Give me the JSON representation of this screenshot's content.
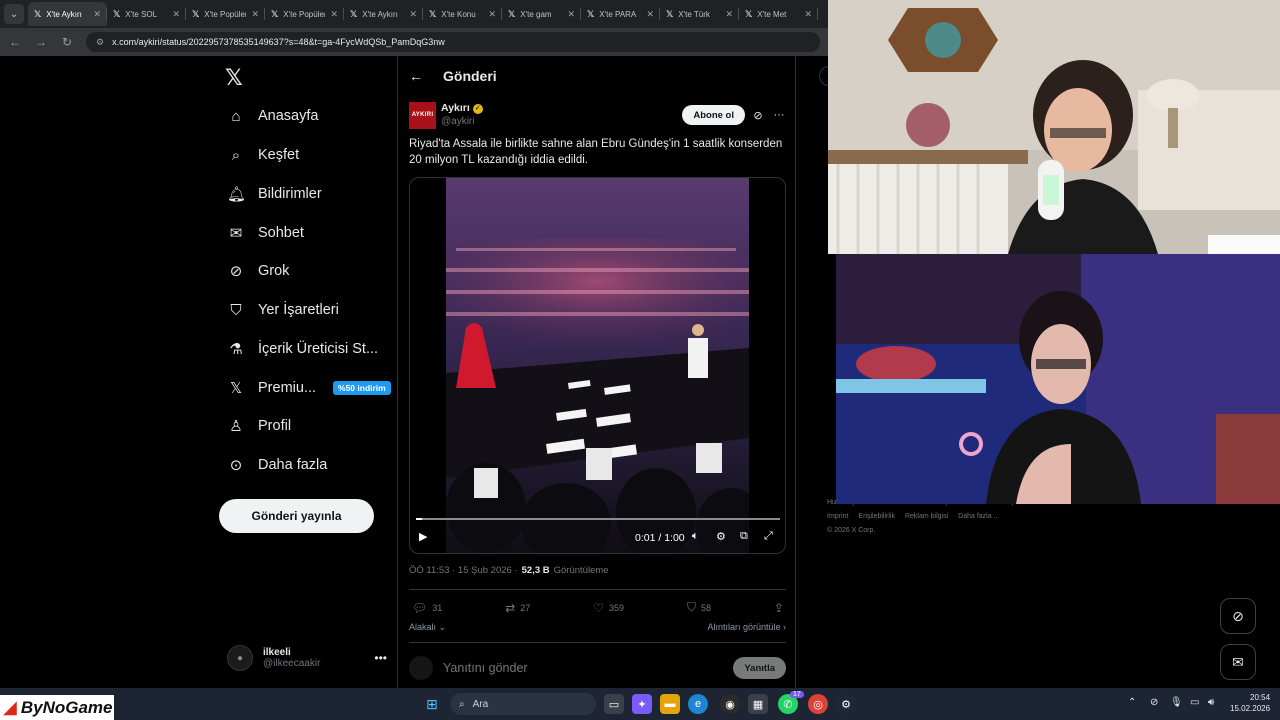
{
  "browser": {
    "tabs": [
      {
        "label": "X'te Aykırı",
        "active": true
      },
      {
        "label": "X'te SOL",
        "active": false
      },
      {
        "label": "X'te Popüler",
        "active": false
      },
      {
        "label": "X'te Popüler",
        "active": false
      },
      {
        "label": "X'te Aykırı",
        "active": false
      },
      {
        "label": "X'te Konu",
        "active": false
      },
      {
        "label": "X'te gam",
        "active": false
      },
      {
        "label": "X'te PARA",
        "active": false
      },
      {
        "label": "X'te Türk",
        "active": false
      },
      {
        "label": "X'te Met",
        "active": false
      }
    ],
    "url": "x.com/aykiri/status/2022957378535149637?s=48&t=ga-4FycWdQSb_PamDqG3nw"
  },
  "sidebar": {
    "logo": "𝕏",
    "items": [
      {
        "label": "Anasayfa",
        "icon": "home-icon",
        "glyph": "⌂"
      },
      {
        "label": "Keşfet",
        "icon": "search-icon",
        "glyph": "⌕"
      },
      {
        "label": "Bildirimler",
        "icon": "bell-icon",
        "glyph": "🔔︎"
      },
      {
        "label": "Sohbet",
        "icon": "mail-icon",
        "glyph": "✉"
      },
      {
        "label": "Grok",
        "icon": "grok-icon",
        "glyph": "⊘"
      },
      {
        "label": "Yer İşaretleri",
        "icon": "bookmark-icon",
        "glyph": "⛉"
      },
      {
        "label": "İçerik Üreticisi St...",
        "icon": "flask-icon",
        "glyph": "⚗"
      },
      {
        "label": "Premiu...",
        "icon": "premium-x-icon",
        "glyph": "𝕏"
      },
      {
        "label": "Profil",
        "icon": "profile-icon",
        "glyph": "♙"
      },
      {
        "label": "Daha fazla",
        "icon": "more-circle-icon",
        "glyph": "⊙"
      }
    ],
    "premium_badge": "%50 indirim",
    "post_button": "Gönderi yayınla",
    "account": {
      "name": "ilkeeli",
      "handle": "@ilkeecaakir"
    }
  },
  "post": {
    "header_title": "Gönderi",
    "author_name": "Aykırı",
    "author_handle": "@aykiri",
    "avatar_text": "AYKIRI",
    "follow_label": "Abone ol",
    "text": "Riyad'ta Assala ile birlikte sahne alan Ebru Gündeş'in 1 saatlik konserden 20 milyon TL kazandığı iddia edildi.",
    "video": {
      "time": "0:01 / 1:00",
      "progress_fraction": 0.017
    },
    "timestamp": "ÖÖ 11:53 · 15 Şub 2026 ·",
    "views_count": "52,3 B",
    "views_label": "Görüntüleme",
    "replies": "31",
    "reposts": "27",
    "likes": "359",
    "bookmarks": "58",
    "sort_label": "Alakalı",
    "quotes_label": "Alıntıları görüntüle",
    "reply_placeholder": "Yanıtını gönder",
    "reply_button": "Yanıtla"
  },
  "footer": {
    "row1": [
      "Hizmet Şartları",
      "Gizlilik Politikası",
      "Çerez Politikası",
      "Erişilebilirlik"
    ],
    "row2": [
      "Imprint",
      "Erişilebilirlik",
      "Reklam bilgisi",
      "Daha fazla ..."
    ],
    "copyright": "© 2026 X Corp."
  },
  "taskbar": {
    "brand": "ByNoGame",
    "search_placeholder": "Ara",
    "whatsapp_badge": "17",
    "time": "20:54",
    "date": "15.02.2026"
  },
  "colors": {
    "accent": "#1d9bf0",
    "verified": "#e2b719",
    "brand_red": "#e1251b"
  }
}
